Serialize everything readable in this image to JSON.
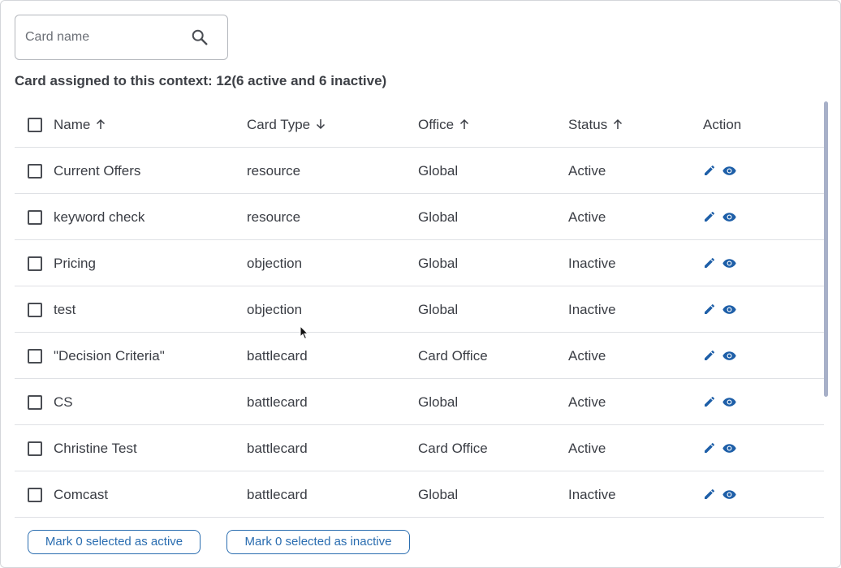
{
  "search": {
    "placeholder": "Card name",
    "value": ""
  },
  "summary": "Card assigned to this context: 12(6 active and 6 inactive)",
  "columns": [
    {
      "label": "Name",
      "sort": "asc"
    },
    {
      "label": "Card Type",
      "sort": "desc"
    },
    {
      "label": "Office",
      "sort": "asc"
    },
    {
      "label": "Status",
      "sort": "asc"
    },
    {
      "label": "Action",
      "sort": "none"
    }
  ],
  "rows": [
    {
      "name": "Current Offers",
      "type": "resource",
      "office": "Global",
      "status": "Active"
    },
    {
      "name": "keyword check",
      "type": "resource",
      "office": "Global",
      "status": "Active"
    },
    {
      "name": "Pricing",
      "type": "objection",
      "office": "Global",
      "status": "Inactive"
    },
    {
      "name": "test",
      "type": "objection",
      "office": "Global",
      "status": "Inactive"
    },
    {
      "name": "\"Decision Criteria\"",
      "type": "battlecard",
      "office": "Card Office",
      "status": "Active"
    },
    {
      "name": "CS",
      "type": "battlecard",
      "office": "Global",
      "status": "Active"
    },
    {
      "name": "Christine Test",
      "type": "battlecard",
      "office": "Card Office",
      "status": "Active"
    },
    {
      "name": "Comcast",
      "type": "battlecard",
      "office": "Global",
      "status": "Inactive"
    }
  ],
  "actions": {
    "mark_active_label": "Mark 0 selected as active",
    "mark_inactive_label": "Mark 0 selected as inactive"
  },
  "colors": {
    "accent": "#2a6db0",
    "icon_blue": "#1e5fa8",
    "scroll_thumb": "#a7b0c8"
  },
  "icons": {
    "search": "search-icon",
    "edit": "pencil-icon",
    "view": "eye-icon",
    "sort_up": "arrow-up-icon",
    "sort_down": "arrow-down-icon"
  }
}
